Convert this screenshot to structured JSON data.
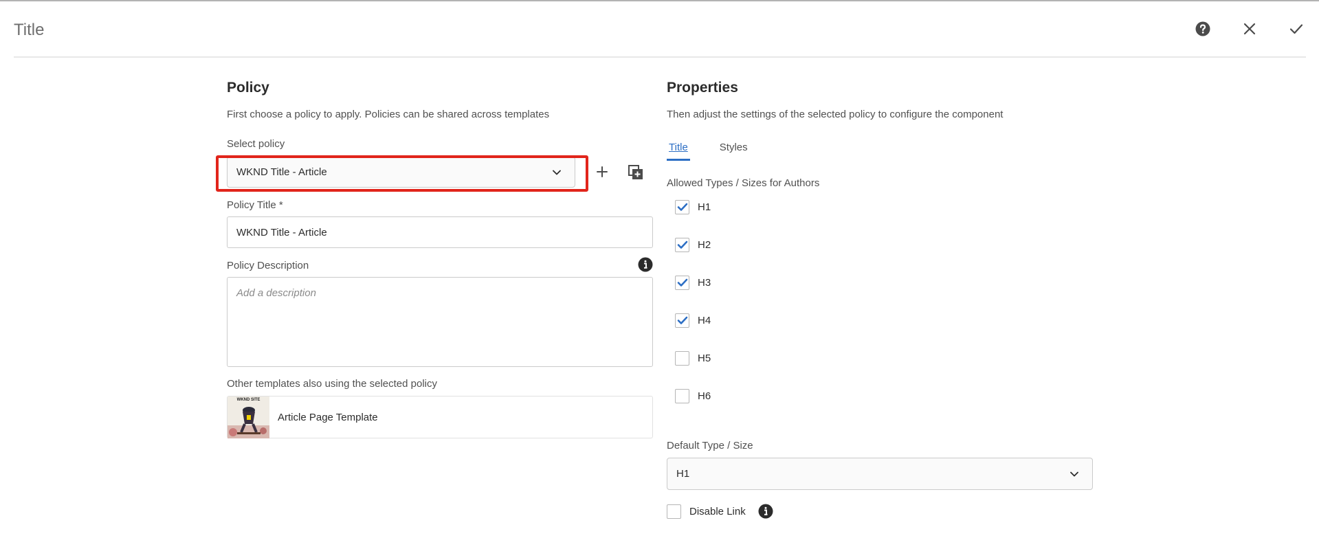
{
  "header": {
    "title": "Title",
    "help_icon": "help-icon",
    "close_icon": "close-icon",
    "confirm_icon": "check-icon"
  },
  "policy": {
    "title": "Policy",
    "description": "First choose a policy to apply. Policies can be shared across templates",
    "select_label": "Select policy",
    "selected_policy": "WKND Title - Article",
    "policy_title_label": "Policy Title *",
    "policy_title_value": "WKND Title - Article",
    "policy_description_label": "Policy Description",
    "policy_description_placeholder": "Add a description",
    "other_templates_label": "Other templates also using the selected policy",
    "template_name": "Article Page Template",
    "thumb_caption": "WKND SITE"
  },
  "properties": {
    "title": "Properties",
    "description": "Then adjust the settings of the selected policy to configure the component",
    "tabs": [
      {
        "label": "Title",
        "active": true
      },
      {
        "label": "Styles",
        "active": false
      }
    ],
    "allowed_label": "Allowed Types / Sizes for Authors",
    "allowed_types": [
      {
        "label": "H1",
        "checked": true
      },
      {
        "label": "H2",
        "checked": true
      },
      {
        "label": "H3",
        "checked": true
      },
      {
        "label": "H4",
        "checked": true
      },
      {
        "label": "H5",
        "checked": false
      },
      {
        "label": "H6",
        "checked": false
      }
    ],
    "default_label": "Default Type / Size",
    "default_value": "H1",
    "disable_link_label": "Disable Link",
    "disable_link_checked": false
  },
  "colors": {
    "accent": "#2c6ec4",
    "highlight": "#e1251b"
  }
}
